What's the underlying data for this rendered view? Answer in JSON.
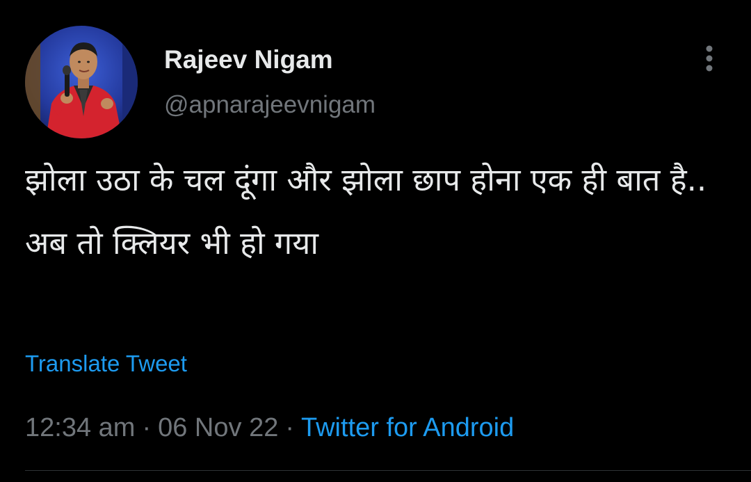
{
  "author": {
    "display_name": "Rajeev Nigam",
    "handle": "@apnarajeevnigam",
    "avatar_icon": "profile-photo"
  },
  "tweet": {
    "text": "झोला उठा के चल दूंगा और झोला छाप होना एक ही बात है.. अब तो क्लियर भी हो गया",
    "translate_label": "Translate Tweet",
    "time": "12:34 am",
    "separator": "·",
    "date": "06 Nov 22",
    "source": "Twitter for Android"
  },
  "actions": {
    "more_icon": "more-vertical-icon"
  },
  "colors": {
    "background": "#000000",
    "text": "#e7e9ea",
    "secondary_text": "#71767b",
    "link": "#1d9bf0"
  }
}
